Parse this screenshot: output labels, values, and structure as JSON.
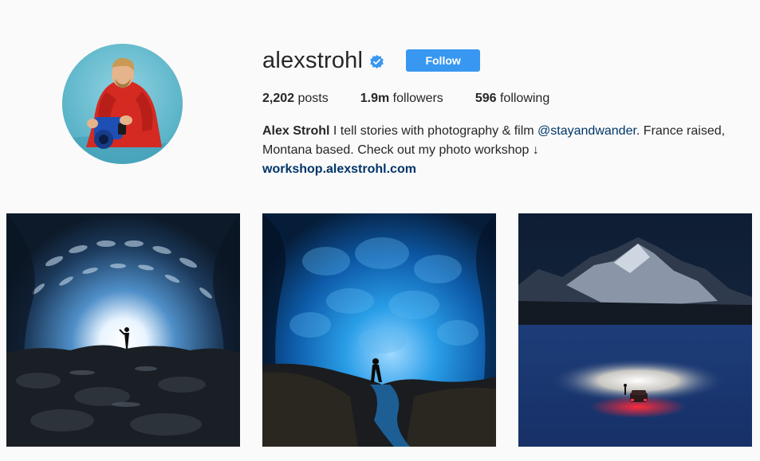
{
  "profile": {
    "username": "alexstrohl",
    "verified": true,
    "verified_icon": "verified-badge-icon",
    "follow_label": "Follow",
    "accent_color": "#3897f0"
  },
  "stats": {
    "posts_count": "2,202",
    "posts_label": "posts",
    "followers_count": "1.9m",
    "followers_label": "followers",
    "following_count": "596",
    "following_label": "following"
  },
  "bio": {
    "name": "Alex Strohl",
    "text_1": " I tell stories with photography & film ",
    "mention": "@stayandwander",
    "text_2": ". France raised, Montana based. Check out my photo workshop ↓",
    "link": "workshop.alexstrohl.com"
  },
  "posts": [
    {
      "subject": "ice cave with bright opening and person silhouette"
    },
    {
      "subject": "blue ice cave with person standing on rocks"
    },
    {
      "subject": "frozen lake at night with car headlights below mountains"
    }
  ]
}
